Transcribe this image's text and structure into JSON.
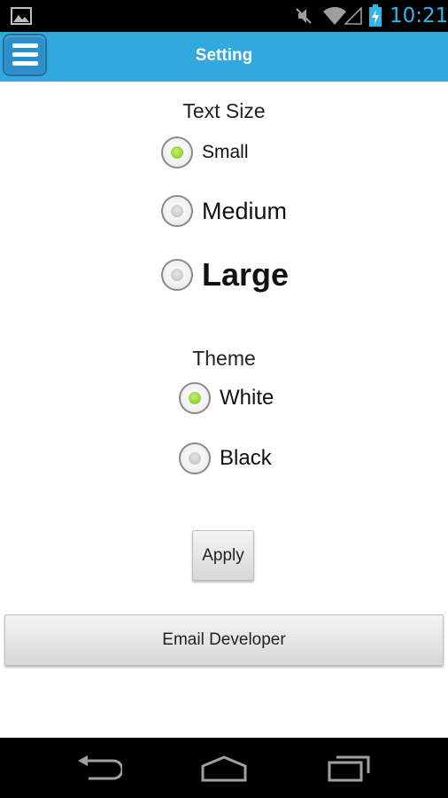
{
  "status_bar": {
    "time": "10:21",
    "icons": [
      "gallery-icon",
      "mute-icon",
      "wifi-icon",
      "signal-icon",
      "battery-charging-icon"
    ],
    "accent_color": "#33b5e5"
  },
  "action_bar": {
    "title": "Setting",
    "menu_icon": "hamburger-menu-icon",
    "color": "#33a8df"
  },
  "text_size": {
    "label": "Text Size",
    "options": [
      {
        "label": "Small",
        "checked": true
      },
      {
        "label": "Medium",
        "checked": false
      },
      {
        "label": "Large",
        "checked": false
      }
    ]
  },
  "theme": {
    "label": "Theme",
    "options": [
      {
        "label": "White",
        "checked": true
      },
      {
        "label": "Black",
        "checked": false
      }
    ]
  },
  "buttons": {
    "apply": "Apply",
    "email_developer": "Email Developer"
  },
  "nav_bar": {
    "icons": [
      "back-icon",
      "home-icon",
      "recent-apps-icon"
    ]
  }
}
